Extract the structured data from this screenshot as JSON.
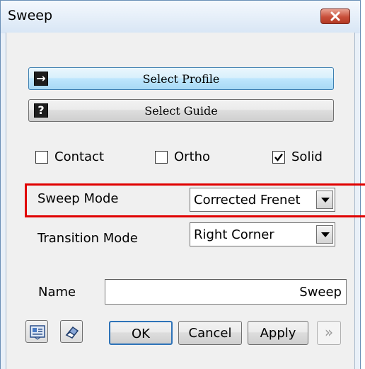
{
  "window": {
    "title": "Sweep"
  },
  "buttons": {
    "select_profile": "Select Profile",
    "select_guide": "Select Guide",
    "ok": "OK",
    "cancel": "Cancel",
    "apply": "Apply",
    "more": "»"
  },
  "icons": {
    "profile_icon_glyph": "→",
    "guide_icon_glyph": "?",
    "close": "close-icon",
    "preview": "preview-icon",
    "eraser": "eraser-icon"
  },
  "options": {
    "contact": {
      "label": "Contact",
      "checked": false
    },
    "ortho": {
      "label": "Ortho",
      "checked": false
    },
    "solid": {
      "label": "Solid",
      "checked": true
    }
  },
  "sweep_mode": {
    "label": "Sweep Mode",
    "value": "Corrected Frenet"
  },
  "transition_mode": {
    "label": "Transition Mode",
    "value": "Right Corner"
  },
  "name": {
    "label": "Name",
    "value": "Sweep"
  },
  "colors": {
    "highlight": "#e00000",
    "close_button": "#c84f3a",
    "profile_button": "#bee6fd"
  }
}
